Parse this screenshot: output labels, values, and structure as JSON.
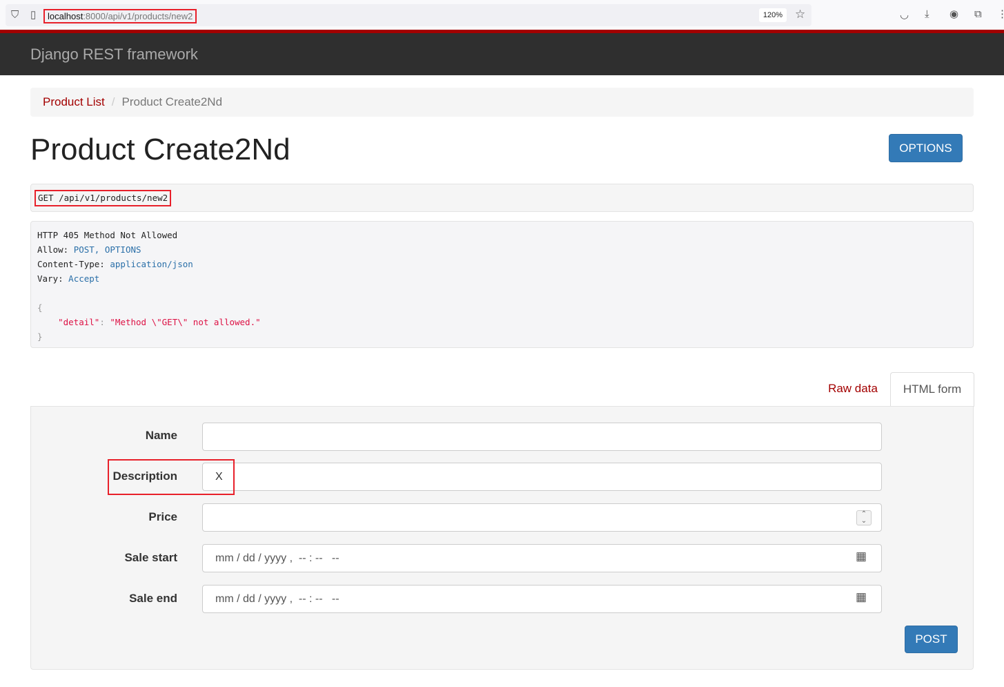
{
  "browser": {
    "url_host": "localhost",
    "url_path": ":8000/api/v1/products/new2",
    "zoom": "120%"
  },
  "navbar": {
    "brand": "Django REST framework"
  },
  "breadcrumb": [
    {
      "label": "Product List"
    },
    {
      "label": "Product Create2Nd"
    }
  ],
  "page": {
    "title": "Product Create2Nd",
    "options_label": "OPTIONS"
  },
  "request": {
    "method": "GET",
    "path": "/api/v1/products/new2"
  },
  "response": {
    "status": "HTTP 405 Method Not Allowed",
    "headers": [
      {
        "k": "Allow:",
        "v": "POST, OPTIONS"
      },
      {
        "k": "Content-Type:",
        "v": "application/json"
      },
      {
        "k": "Vary:",
        "v": "Accept"
      }
    ],
    "open": "{",
    "key": "\"detail\"",
    "colon": ": ",
    "value": "\"Method \\\"GET\\\" not allowed.\"",
    "close": "}"
  },
  "tabs": {
    "raw": "Raw data",
    "html": "HTML form"
  },
  "form": {
    "fields": [
      {
        "label": "Name",
        "value": ""
      },
      {
        "label": "Description",
        "value": "X"
      },
      {
        "label": "Price",
        "value": ""
      },
      {
        "label": "Sale start",
        "placeholder": "mm / dd / yyyy ,  -- : --   --"
      },
      {
        "label": "Sale end",
        "placeholder": "mm / dd / yyyy ,  -- : --   --"
      }
    ],
    "submit": "POST"
  }
}
